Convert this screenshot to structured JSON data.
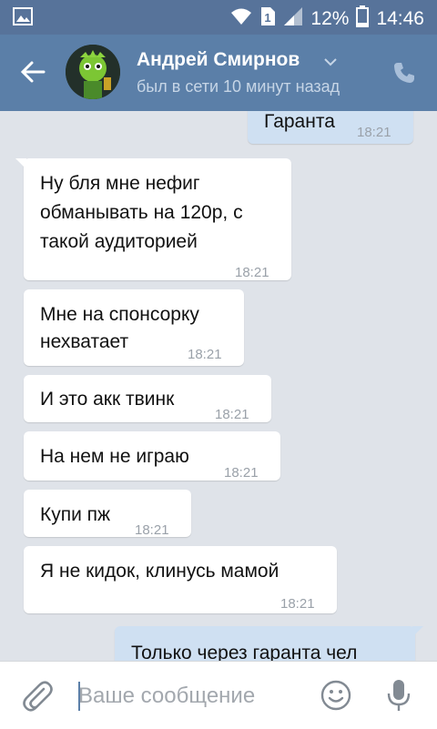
{
  "status_bar": {
    "battery": "12%",
    "time": "14:46"
  },
  "header": {
    "name": "Андрей Смирнов",
    "last_seen": "был в сети 10 минут назад"
  },
  "messages": [
    {
      "dir": "out",
      "lines": [
        "Гаранта"
      ],
      "time": "18:21"
    },
    {
      "dir": "in",
      "lines": [
        "Ну бля мне нефиг",
        "обманывать на 120р, с",
        "такой аудиторией"
      ],
      "time": "18:21"
    },
    {
      "dir": "in",
      "lines": [
        "Мне на спонсорку",
        "нехватает"
      ],
      "time": "18:21"
    },
    {
      "dir": "in",
      "lines": [
        "И это акк твинк"
      ],
      "time": "18:21"
    },
    {
      "dir": "in",
      "lines": [
        "На нем не играю"
      ],
      "time": "18:21"
    },
    {
      "dir": "in",
      "lines": [
        "Купи пж"
      ],
      "time": "18:21"
    },
    {
      "dir": "in",
      "lines": [
        "Я не кидок, клинусь мамой"
      ],
      "time": "18:21"
    },
    {
      "dir": "out",
      "lines": [
        "Только через гаранта чел"
      ],
      "time": ""
    }
  ],
  "composer": {
    "placeholder": "Ваше сообщение"
  },
  "colors": {
    "header": "#5b7fa8",
    "statusbar": "#57739a",
    "chat_bg": "#dfe3e9",
    "outgoing": "#cfe0f2"
  }
}
